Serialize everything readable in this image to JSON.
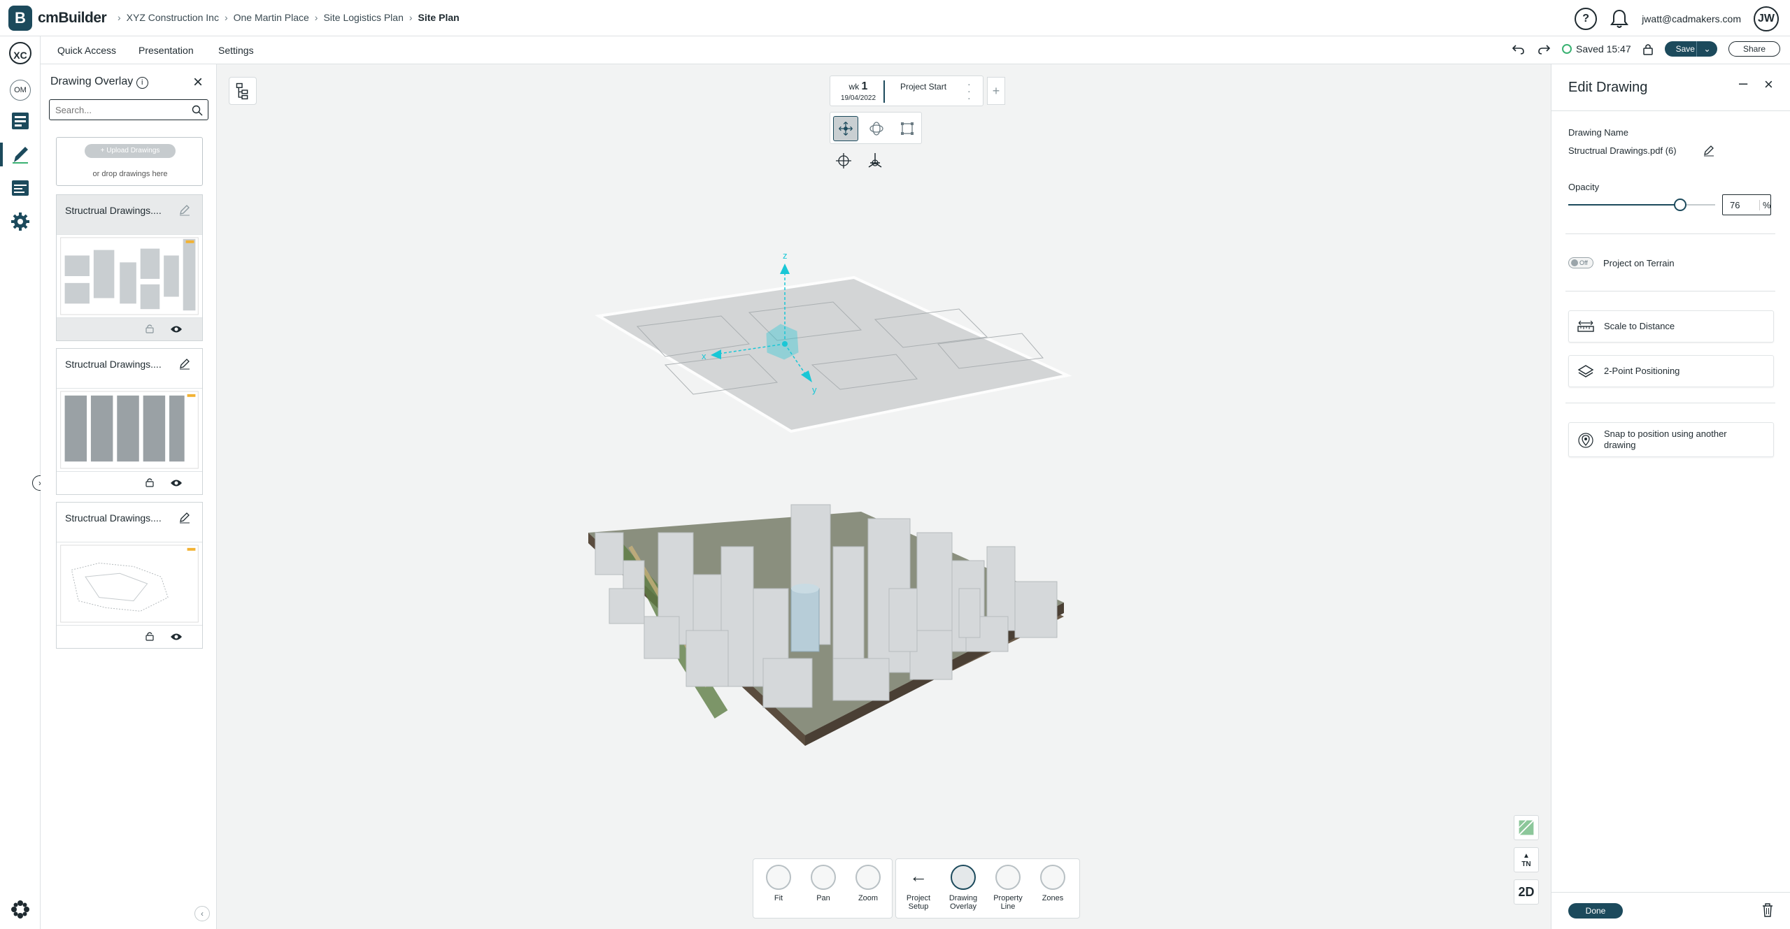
{
  "app": {
    "brand": "cmBuilder",
    "logo_letter": "B"
  },
  "breadcrumbs": [
    "XYZ Construction Inc",
    "One Martin Place",
    "Site Logistics Plan",
    "Site Plan"
  ],
  "user": {
    "email": "jwatt@cadmakers.com",
    "initials": "JW",
    "help": "?"
  },
  "rail": {
    "company": "XC",
    "project": "OM"
  },
  "menu": {
    "items": [
      "Quick Access",
      "Presentation",
      "Settings"
    ],
    "saved": "Saved 15:47",
    "save": "Save",
    "share": "Share"
  },
  "left_panel": {
    "title": "Drawing Overlay",
    "search_placeholder": "Search...",
    "upload_label": "+ Upload Drawings",
    "drop_hint": "or drop drawings here",
    "cards": [
      {
        "title": "Structrual Drawings....",
        "selected": true
      },
      {
        "title": "Structrual Drawings....",
        "selected": false
      },
      {
        "title": "Structrual Drawings....",
        "selected": false
      }
    ]
  },
  "timeline": {
    "wk_label": "wk",
    "wk_number": "1",
    "date": "19/04/2022",
    "milestone": "Project Start"
  },
  "viewport": {
    "axis": {
      "x": "x",
      "y": "y",
      "z": "z"
    },
    "side": {
      "tn": "TN",
      "mode": "2D"
    }
  },
  "bottom_toolbar": {
    "view": [
      "Fit",
      "Pan",
      "Zoom"
    ],
    "project": [
      "Project Setup",
      "Drawing Overlay",
      "Property Line",
      "Zones"
    ]
  },
  "right_panel": {
    "title": "Edit Drawing",
    "drawing_name_label": "Drawing Name",
    "drawing_name": "Structrual Drawings.pdf (6)",
    "opacity_label": "Opacity",
    "opacity_value": "76",
    "opacity_unit": "%",
    "opacity_fraction": 0.76,
    "toggle_state": "Off",
    "project_on_terrain": "Project on Terrain",
    "scale_to_distance": "Scale to Distance",
    "two_point": "2-Point Positioning",
    "snap_line1": "Snap to position using another",
    "snap_line2": "drawing",
    "done": "Done"
  },
  "colors": {
    "accent": "#1c4a5c",
    "ok": "#3bb273",
    "gizmo": "#19c7d6"
  }
}
